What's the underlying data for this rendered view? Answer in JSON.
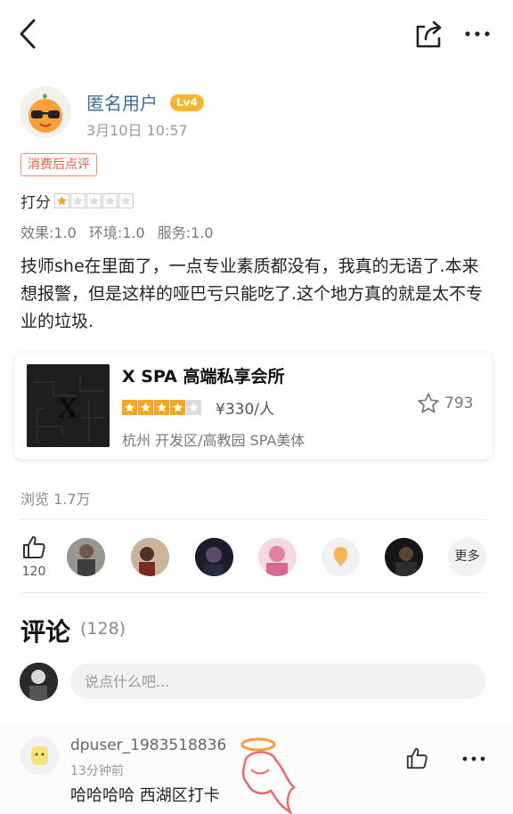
{
  "header": {
    "back_icon": "chevron-left-icon",
    "share_icon": "share-icon",
    "more_icon": "more-dots-icon"
  },
  "author": {
    "name": "匿名用户",
    "level": "Lv4",
    "time": "3月10日  10:57",
    "avatar_icon": "orange-sunglasses-avatar"
  },
  "review": {
    "tag": "消费后点评",
    "score_label": "打分",
    "rating": 1,
    "sub_scores": [
      "效果:1.0",
      "环境:1.0",
      "服务:1.0"
    ],
    "text": "技师she在里面了，一点专业素质都没有，我真的无语了.本来想报警，但是这样的哑巴亏只能吃了.这个地方真的就是太不专业的垃圾."
  },
  "shop": {
    "name": "X SPA 高端私享会所",
    "rating": 4,
    "price": "¥330/人",
    "favorites": "793",
    "area": "杭州  开发区/高教园  SPA美体",
    "thumb_letter": "X"
  },
  "stats": {
    "views": "浏览 1.7万",
    "likes": "120",
    "more_likers": "更多"
  },
  "comments": {
    "title": "评论",
    "count": "(128)",
    "input_placeholder": "说点什么吧...",
    "items": [
      {
        "user": "dpuser_1983518836",
        "time": "13分钟前",
        "text": "哈哈哈哈 西湖区打卡"
      }
    ]
  },
  "colors": {
    "link_blue": "#3e6c9c",
    "level_orange": "#f5b62e",
    "tag_red": "#f05a3c",
    "star_orange": "#f5a623"
  }
}
